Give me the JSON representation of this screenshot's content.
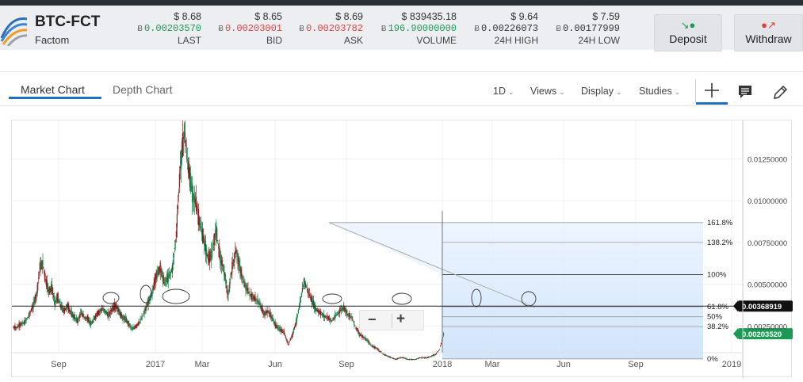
{
  "header": {
    "pair": "BTC-FCT",
    "coin_name": "Factom",
    "stats": [
      {
        "usd": "$ 8.68",
        "btc": "0.00203570",
        "label": "LAST",
        "btc_color": "green"
      },
      {
        "usd": "$ 8.65",
        "btc": "0.00203001",
        "label": "BID",
        "btc_color": "red"
      },
      {
        "usd": "$ 8.69",
        "btc": "0.00203782",
        "label": "ASK",
        "btc_color": "red"
      },
      {
        "usd": "$ 839435.18",
        "btc": "196.90000000",
        "label": "VOLUME",
        "btc_color": "green"
      },
      {
        "usd": "$ 9.64",
        "btc": "0.00226073",
        "label": "24H HIGH",
        "btc_color": "default"
      },
      {
        "usd": "$ 7.59",
        "btc": "0.00177999",
        "label": "24H LOW",
        "btc_color": "default"
      }
    ],
    "btc_symbol": "Ƀ",
    "deposit_label": "Deposit",
    "withdraw_label": "Withdraw",
    "deposit_icon": "arrow-down-icon",
    "withdraw_icon": "arrow-up-icon"
  },
  "tabs": [
    {
      "label": "Market Chart",
      "active": true
    },
    {
      "label": "Depth Chart",
      "active": false
    }
  ],
  "toolbar": {
    "interval": "1D",
    "views": "Views",
    "display": "Display",
    "studies": "Studies",
    "icons": [
      "crosshair-icon",
      "comment-icon",
      "pencil-icon"
    ]
  },
  "zoom": {
    "minus": "−",
    "plus": "+"
  },
  "chart_data": {
    "type": "candlestick",
    "x_tick_labels": [
      "Sep",
      "2017",
      "Mar",
      "Jun",
      "Sep",
      "2018",
      "Mar",
      "Jun",
      "Sep",
      "2019"
    ],
    "y_tick_labels": [
      "0.01250000",
      "0.01000000",
      "0.00750000",
      "0.00500000",
      "0.00250000"
    ],
    "ylim": [
      0.0009,
      0.0148
    ],
    "price_line": {
      "label": "0.00368919",
      "value": 0.00368919
    },
    "last_price": {
      "label": "0.00203520",
      "value": 0.0020352
    },
    "fibonacci": [
      {
        "label": "161.8%",
        "value": 0.00869
      },
      {
        "label": "138.2%",
        "value": 0.0075
      },
      {
        "label": "100%",
        "value": 0.00557
      },
      {
        "label": "61.8%",
        "value": 0.00365
      },
      {
        "label": "50%",
        "value": 0.00305
      },
      {
        "label": "38.2%",
        "value": 0.00246
      },
      {
        "label": "0%",
        "value": 0.00053
      }
    ],
    "series": [
      {
        "month": 0,
        "values": [
          0.0024,
          0.0026,
          0.0027,
          0.0031,
          0.0036,
          0.0044
        ]
      },
      {
        "month": 1,
        "values": [
          0.006,
          0.0062,
          0.0052,
          0.0046,
          0.0048,
          0.0039,
          0.0042,
          0.0037
        ]
      },
      {
        "month": 2,
        "values": [
          0.0034,
          0.0037,
          0.0033,
          0.003,
          0.0028,
          0.0033,
          0.003
        ]
      },
      {
        "month": 3,
        "values": [
          0.0029,
          0.0026,
          0.003,
          0.0033,
          0.0035,
          0.0034,
          0.0031
        ]
      },
      {
        "month": 4,
        "values": [
          0.0035,
          0.0037,
          0.0034,
          0.003,
          0.0029,
          0.0026,
          0.0023
        ]
      },
      {
        "month": 5,
        "values": [
          0.0025,
          0.0028,
          0.0033,
          0.0039,
          0.0045,
          0.0055
        ]
      },
      {
        "month": 6,
        "values": [
          0.006,
          0.0051,
          0.0054,
          0.0059,
          0.008,
          0.012
        ]
      },
      {
        "month": 7,
        "values": [
          0.0142,
          0.012,
          0.0105,
          0.0098,
          0.0085,
          0.0075
        ]
      },
      {
        "month": 8,
        "values": [
          0.0065,
          0.0068,
          0.0083,
          0.0066,
          0.0058,
          0.0042
        ]
      },
      {
        "month": 9,
        "values": [
          0.006,
          0.007,
          0.0059,
          0.005,
          0.0046,
          0.0042
        ]
      },
      {
        "month": 10,
        "values": [
          0.0041,
          0.0038,
          0.0032,
          0.0034,
          0.003,
          0.0025
        ]
      },
      {
        "month": 11,
        "values": [
          0.0023,
          0.0021,
          0.0014,
          0.0019,
          0.0027,
          0.0038
        ]
      },
      {
        "month": 12,
        "values": [
          0.0052,
          0.0046,
          0.004,
          0.0035,
          0.0033,
          0.0031
        ]
      },
      {
        "month": 13,
        "values": [
          0.003,
          0.0028,
          0.0031,
          0.0034,
          0.0036,
          0.0032
        ]
      },
      {
        "month": 14,
        "values": [
          0.003,
          0.0024,
          0.002,
          0.0018,
          0.0016,
          0.0013
        ]
      },
      {
        "month": 15,
        "values": [
          0.0012,
          0.001,
          0.0008,
          0.0007,
          0.0006,
          0.0005
        ]
      },
      {
        "month": 16,
        "values": [
          0.0006,
          0.0006,
          0.0005,
          0.0005,
          0.0005,
          0.0006
        ]
      },
      {
        "month": 17,
        "values": [
          0.0006,
          0.0006,
          0.0007,
          0.0008,
          0.0011,
          0.002
        ]
      }
    ]
  }
}
